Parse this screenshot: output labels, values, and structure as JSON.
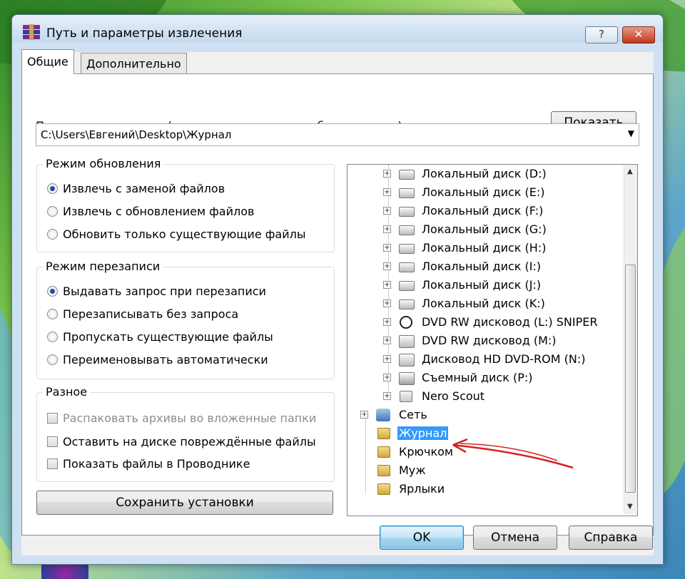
{
  "window": {
    "title": "Путь и параметры извлечения",
    "help_label": "?",
    "close_label": "✕"
  },
  "tabs": [
    {
      "label": "Общие",
      "active": true
    },
    {
      "label": "Дополнительно",
      "active": false
    }
  ],
  "path": {
    "label": "Путь для извлечения (если не существует, то будет создан):",
    "value": "C:\\Users\\Евгений\\Desktop\\Журнал",
    "show_button": "Показать"
  },
  "update_mode": {
    "title": "Режим обновления",
    "options": [
      {
        "label": "Извлечь с заменой файлов",
        "selected": true
      },
      {
        "label": "Извлечь с обновлением файлов",
        "selected": false
      },
      {
        "label": "Обновить только существующие файлы",
        "selected": false
      }
    ]
  },
  "overwrite_mode": {
    "title": "Режим перезаписи",
    "options": [
      {
        "label": "Выдавать запрос при перезаписи",
        "selected": true
      },
      {
        "label": "Перезаписывать без запроса",
        "selected": false
      },
      {
        "label": "Пропускать существующие файлы",
        "selected": false
      },
      {
        "label": "Переименовывать автоматически",
        "selected": false
      }
    ]
  },
  "misc": {
    "title": "Разное",
    "options": [
      {
        "label": "Распаковать архивы во вложенные папки",
        "checked": false,
        "disabled": true
      },
      {
        "label": "Оставить на диске повреждённые файлы",
        "checked": false,
        "disabled": false
      },
      {
        "label": "Показать файлы в Проводнике",
        "checked": false,
        "disabled": false
      }
    ]
  },
  "save_settings_label": "Сохранить установки",
  "tree": {
    "items": [
      {
        "label": "Локальный диск (D:)",
        "icon": "drive-icon"
      },
      {
        "label": "Локальный диск (E:)",
        "icon": "drive-icon"
      },
      {
        "label": "Локальный диск (F:)",
        "icon": "drive-icon"
      },
      {
        "label": "Локальный диск (G:)",
        "icon": "drive-icon"
      },
      {
        "label": "Локальный диск (H:)",
        "icon": "drive-icon"
      },
      {
        "label": "Локальный диск (I:)",
        "icon": "drive-icon"
      },
      {
        "label": "Локальный диск (J:)",
        "icon": "drive-icon"
      },
      {
        "label": "Локальный диск (K:)",
        "icon": "drive-icon"
      },
      {
        "label": "DVD RW дисковод (L:) SNIPER",
        "icon": "disc-icon"
      },
      {
        "label": "DVD RW дисковод (M:)",
        "icon": "dvd-drive-icon"
      },
      {
        "label": "Дисковод HD DVD-ROM (N:)",
        "icon": "dvd-drive-icon"
      },
      {
        "label": "Съемный диск (P:)",
        "icon": "removable-drive-icon"
      },
      {
        "label": "Nero Scout",
        "icon": "nero-scout-icon"
      },
      {
        "label": "Сеть",
        "icon": "network-icon"
      },
      {
        "label": "Журнал",
        "icon": "folder-icon",
        "selected": true
      },
      {
        "label": "Крючком",
        "icon": "folder-icon"
      },
      {
        "label": "Муж",
        "icon": "folder-icon"
      },
      {
        "label": "Ярлыки",
        "icon": "folder-icon"
      }
    ]
  },
  "buttons": {
    "ok": "OK",
    "cancel": "Отмена",
    "help": "Справка"
  },
  "colors": {
    "selection": "#3399ff",
    "annotation_arrow": "#d62020",
    "window_frame": "#cfe0f1"
  }
}
